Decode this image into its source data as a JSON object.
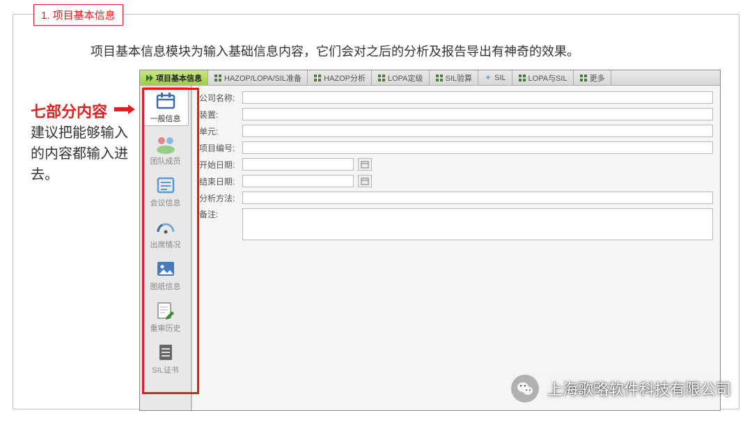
{
  "title_badge": "1. 项目基本信息",
  "intro": "项目基本信息模块为输入基础信息内容，它们会对之后的分析及报告导出有神奇的效果。",
  "annotation": {
    "heading": "七部分内容",
    "body": "建议把能够输入的内容都输入进去。"
  },
  "tabs": [
    {
      "label": "项目基本信息",
      "active": true
    },
    {
      "label": "HAZOP/LOPA/SIL准备",
      "active": false
    },
    {
      "label": "HAZOP分析",
      "active": false
    },
    {
      "label": "LOPA定级",
      "active": false
    },
    {
      "label": "SIL验算",
      "active": false
    },
    {
      "label": "SIL",
      "active": false
    },
    {
      "label": "LOPA与SIL",
      "active": false
    },
    {
      "label": "更多",
      "active": false
    }
  ],
  "sidebar": [
    {
      "label": "一般信息",
      "icon": "calendar",
      "active": true
    },
    {
      "label": "团队成员",
      "icon": "people",
      "active": false
    },
    {
      "label": "会议信息",
      "icon": "list",
      "active": false
    },
    {
      "label": "出席情况",
      "icon": "gauge",
      "active": false
    },
    {
      "label": "图纸信息",
      "icon": "image",
      "active": false
    },
    {
      "label": "重审历史",
      "icon": "edit",
      "active": false
    },
    {
      "label": "SIL证书",
      "icon": "doc",
      "active": false
    }
  ],
  "form": {
    "company_label": "公司名称:",
    "device_label": "装置:",
    "unit_label": "单元:",
    "projno_label": "项目编号:",
    "start_label": "开始日期:",
    "end_label": "结束日期:",
    "method_label": "分析方法:",
    "remark_label": "备注:",
    "company": "",
    "device": "",
    "unit": "",
    "projno": "",
    "start": "",
    "end": "",
    "method": "",
    "remark": ""
  },
  "watermark": "上海歌略软件科技有限公司"
}
